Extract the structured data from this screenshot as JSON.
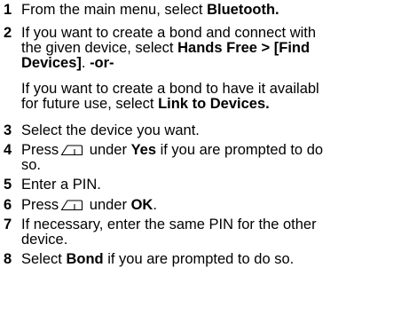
{
  "steps": [
    {
      "number": "1",
      "lines": [
        {
          "pre": "From the main menu, select ",
          "bold": "Bluetooth.",
          "post": ""
        }
      ]
    },
    {
      "number": "2",
      "lines": [
        {
          "pre": "If you want to create a bond and connect with",
          "bold": "",
          "post": ""
        },
        {
          "pre": "the given device, select ",
          "bold": "Hands Free > [Find",
          "post": ""
        },
        {
          "pre": "",
          "bold": "Devices]",
          "post": ". ",
          "bold2": "-or-"
        }
      ]
    },
    {
      "number": "",
      "lines": [
        {
          "pre": "If you want to create a bond to have it availabl",
          "bold": "",
          "post": ""
        },
        {
          "pre": "for future use, select ",
          "bold": "Link to Devices.",
          "post": ""
        }
      ]
    },
    {
      "number": "3",
      "lines": [
        {
          "pre": "Select the device you want.",
          "bold": "",
          "post": ""
        }
      ]
    },
    {
      "number": "4",
      "lines": [
        {
          "pre": "Press",
          "key": "softkey-icon",
          "mid": " under ",
          "bold": "Yes",
          "post": " if you are prompted to do"
        },
        {
          "pre": "so.",
          "bold": "",
          "post": ""
        }
      ]
    },
    {
      "number": "5",
      "lines": [
        {
          "pre": "Enter a PIN.",
          "bold": "",
          "post": ""
        }
      ]
    },
    {
      "number": "6",
      "lines": [
        {
          "pre": "Press",
          "key": "softkey-icon",
          "mid": " under ",
          "bold": "OK",
          "post": "."
        }
      ]
    },
    {
      "number": "7",
      "lines": [
        {
          "pre": "If necessary, enter the same PIN for the other",
          "bold": "",
          "post": ""
        },
        {
          "pre": "device.",
          "bold": "",
          "post": ""
        }
      ]
    },
    {
      "number": "8",
      "lines": [
        {
          "pre": "Select ",
          "bold": "Bond",
          "post": " if you are prompted to do so."
        }
      ]
    }
  ]
}
